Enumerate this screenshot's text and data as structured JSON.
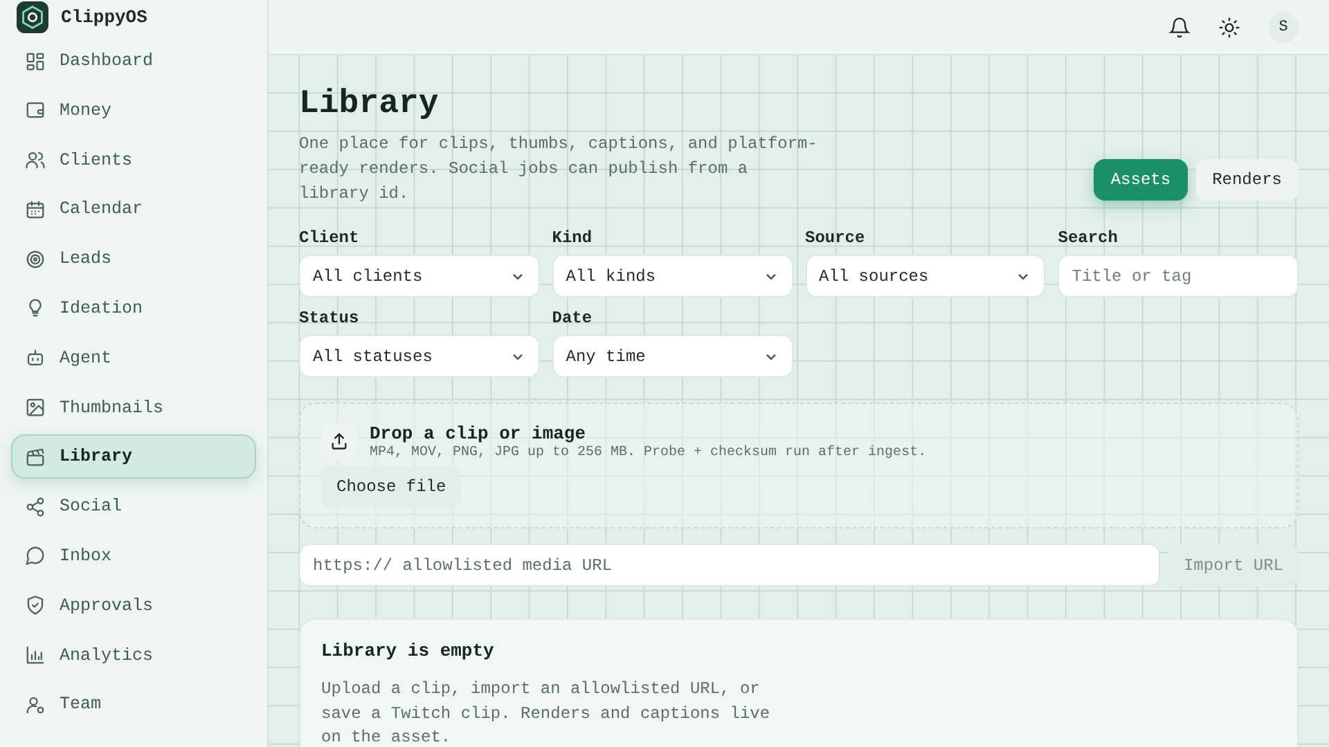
{
  "app": {
    "name": "ClippyOS"
  },
  "sidebar": {
    "items": [
      {
        "label": "Dashboard",
        "selected": false
      },
      {
        "label": "Money",
        "selected": false
      },
      {
        "label": "Clients",
        "selected": false
      },
      {
        "label": "Calendar",
        "selected": false
      },
      {
        "label": "Leads",
        "selected": false
      },
      {
        "label": "Ideation",
        "selected": false
      },
      {
        "label": "Agent",
        "selected": false
      },
      {
        "label": "Thumbnails",
        "selected": false
      },
      {
        "label": "Library",
        "selected": true
      },
      {
        "label": "Social",
        "selected": false
      },
      {
        "label": "Inbox",
        "selected": false
      },
      {
        "label": "Approvals",
        "selected": false
      },
      {
        "label": "Analytics",
        "selected": false
      },
      {
        "label": "Team",
        "selected": false
      }
    ]
  },
  "topbar": {
    "avatar": "S"
  },
  "page": {
    "title": "Library",
    "description": "One place for clips, thumbs, captions, and platform-ready renders. Social jobs can publish from a library id.",
    "tabs": [
      {
        "label": "Assets",
        "selected": true
      },
      {
        "label": "Renders",
        "selected": false
      }
    ]
  },
  "filters": [
    {
      "kind": "select",
      "label": "Client",
      "value": "All clients"
    },
    {
      "kind": "select",
      "label": "Kind",
      "value": "All kinds"
    },
    {
      "kind": "select",
      "label": "Source",
      "value": "All sources"
    },
    {
      "kind": "search",
      "label": "Search",
      "placeholder": "Title or tag"
    },
    {
      "kind": "select",
      "label": "Status",
      "value": "All statuses"
    },
    {
      "kind": "select",
      "label": "Date",
      "value": "Any time"
    }
  ],
  "upload": {
    "title": "Drop a clip or image",
    "hint": "MP4, MOV, PNG, JPG up to 256 MB. Probe + checksum run after ingest.",
    "button": "Choose file"
  },
  "import": {
    "placeholder": "https:// allowlisted media URL",
    "button": "Import URL",
    "disabled": true
  },
  "empty_state": {
    "title": "Library is empty",
    "text": "Upload a clip, import an allowlisted URL, or save a Twitch clip. Renders and captions live on the asset."
  }
}
